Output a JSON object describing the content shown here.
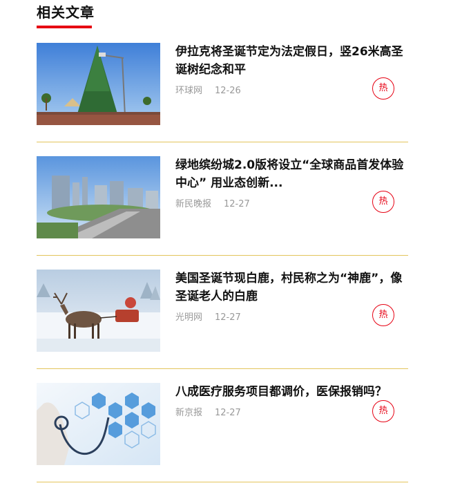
{
  "section": {
    "title": "相关文章"
  },
  "articles": [
    {
      "title": "伊拉克将圣诞节定为法定假日，竖26米高圣诞树纪念和平",
      "source": "环球网",
      "date": "12-26",
      "badge": "热"
    },
    {
      "title": "绿地缤纷城2.0版将设立“全球商品首发体验中心” 用业态创新...",
      "source": "新民晚报",
      "date": "12-27",
      "badge": "热"
    },
    {
      "title": "美国圣诞节现白鹿，村民称之为“神鹿”，像圣诞老人的白鹿",
      "source": "光明网",
      "date": "12-27",
      "badge": "热"
    },
    {
      "title": "八成医疗服务项目都调价，医保报销吗？",
      "source": "新京报",
      "date": "12-27",
      "badge": "热"
    }
  ],
  "colors": {
    "accent": "#e60012",
    "divider": "#e3c45a",
    "meta_text": "#999999"
  }
}
